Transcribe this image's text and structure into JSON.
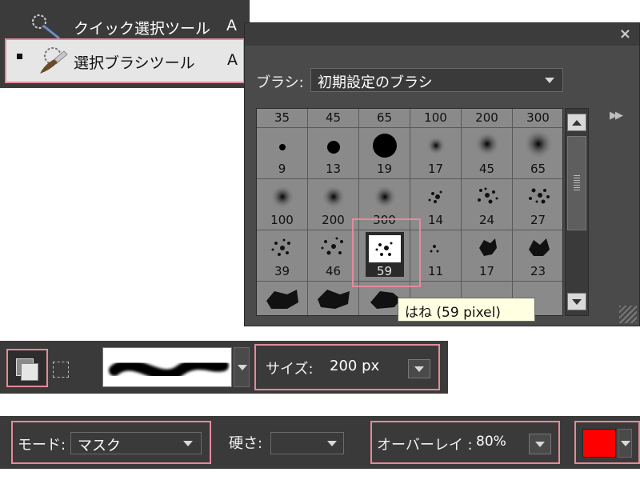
{
  "tool_menu": {
    "items": [
      {
        "label": "クイック選択ツール",
        "shortcut": "A",
        "icon": "quick-selection-icon"
      },
      {
        "label": "選択ブラシツール",
        "shortcut": "A",
        "icon": "selection-brush-icon",
        "selected": true
      }
    ]
  },
  "brush_panel": {
    "close_label": "×",
    "brush_label": "ブラシ:",
    "brush_set": "初期設定のブラシ",
    "header_sizes": [
      "35",
      "45",
      "65",
      "100",
      "200",
      "300"
    ],
    "rows": [
      [
        "9",
        "13",
        "19",
        "17",
        "45",
        "65"
      ],
      [
        "100",
        "200",
        "300",
        "14",
        "24",
        "27"
      ],
      [
        "39",
        "46",
        "59",
        "11",
        "17",
        "23"
      ],
      [
        "",
        "",
        "",
        "",
        "",
        ""
      ]
    ],
    "tooltip": "はね (59 pixel)"
  },
  "options_bar": {
    "size_label": "サイズ:",
    "size_value": "200 px",
    "mode_label": "モード:",
    "mode_value": "マスク",
    "hardness_label": "硬さ:",
    "overlay_label": "オーバーレイ :",
    "overlay_value": "80%",
    "overlay_color": "#ff0000"
  }
}
